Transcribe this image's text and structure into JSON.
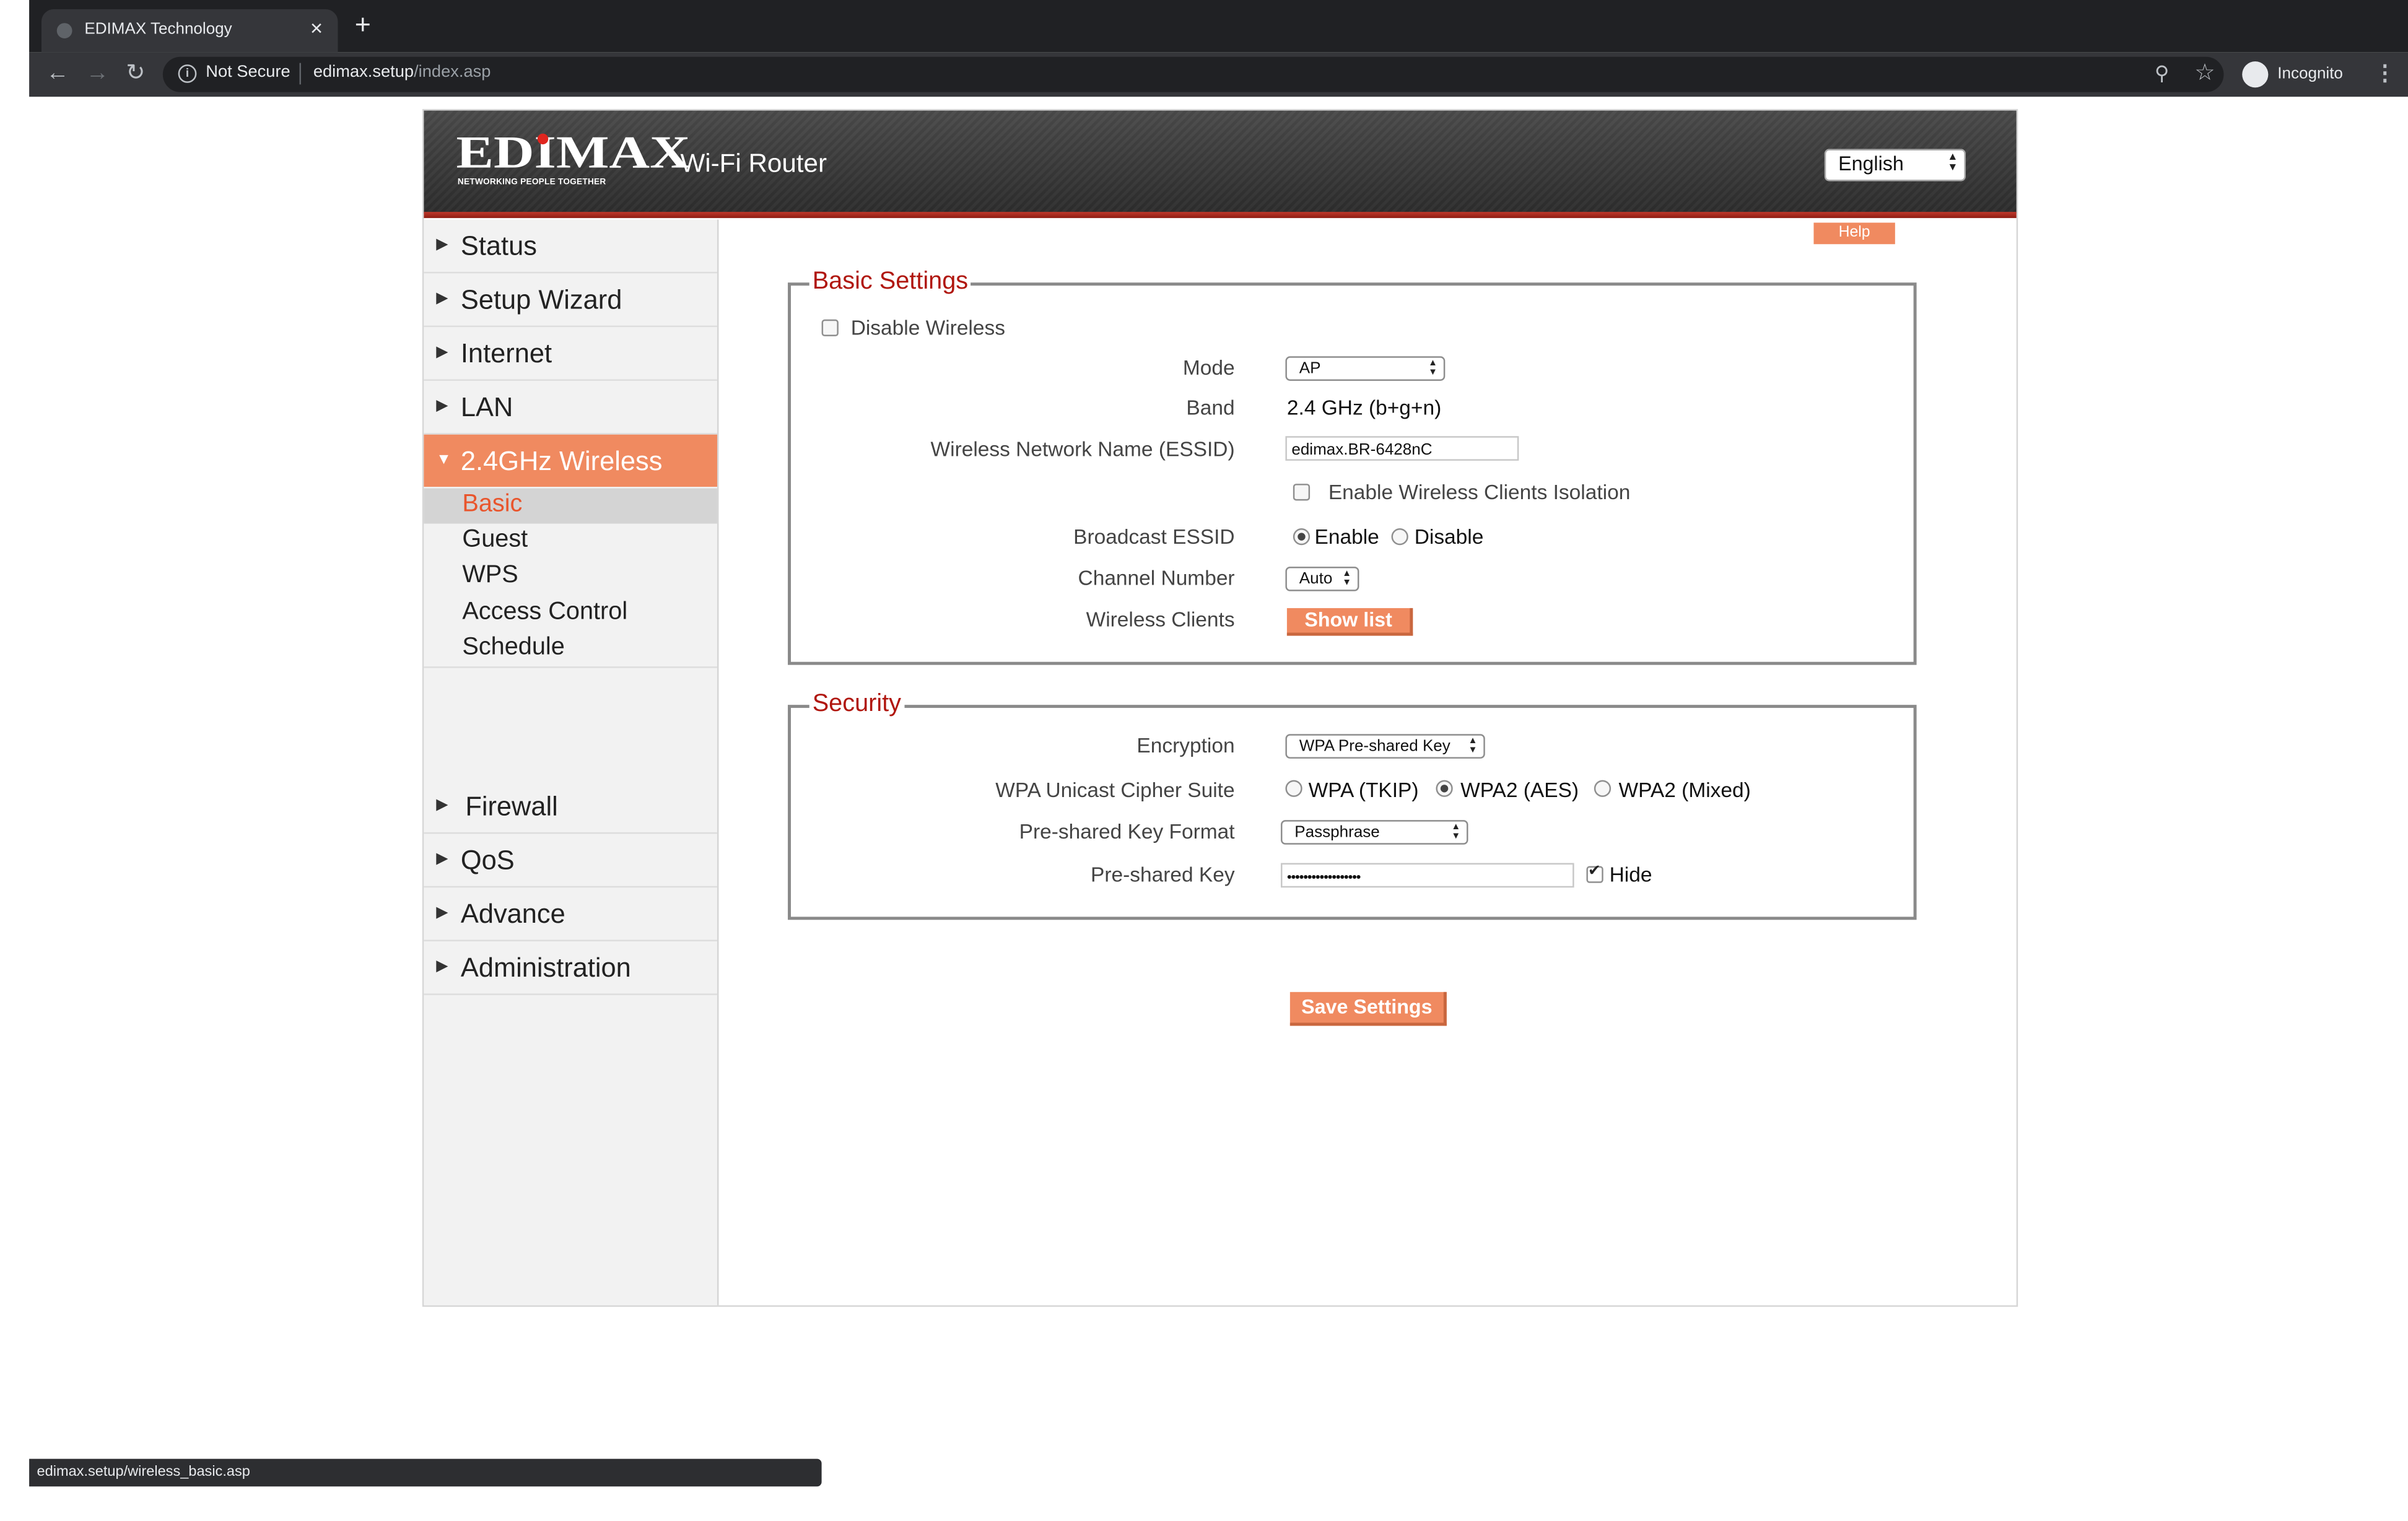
{
  "browser": {
    "tab_title": "EDIMAX Technology",
    "tab_close": "×",
    "new_tab": "+",
    "security_label": "Not Secure",
    "url_host": "edimax.setup",
    "url_path": "/index.asp",
    "profile_label": "Incognito",
    "status_url": "edimax.setup/wireless_basic.asp"
  },
  "header": {
    "logo_text": "EDIMAX",
    "logo_tagline": "NETWORKING PEOPLE TOGETHER",
    "product_name": "Wi-Fi Router",
    "language": "English"
  },
  "sidebar": {
    "items": [
      {
        "label": "Status"
      },
      {
        "label": "Setup Wizard"
      },
      {
        "label": "Internet"
      },
      {
        "label": "LAN"
      },
      {
        "label": "2.4GHz Wireless"
      },
      {
        "label": "Firewall"
      },
      {
        "label": "QoS"
      },
      {
        "label": "Advance"
      },
      {
        "label": "Administration"
      }
    ],
    "wireless_sub": [
      {
        "label": "Basic"
      },
      {
        "label": "Guest"
      },
      {
        "label": "WPS"
      },
      {
        "label": "Access Control"
      },
      {
        "label": "Schedule"
      }
    ]
  },
  "help_label": "Help",
  "basic": {
    "title": "Basic Settings",
    "disable_wireless_label": "Disable  Wireless",
    "disable_wireless_checked": false,
    "mode_label": "Mode",
    "mode_value": "AP",
    "band_label": "Band",
    "band_value": "2.4 GHz (b+g+n)",
    "essid_label": "Wireless Network Name  (ESSID)",
    "essid_value": "edimax.BR-6428nC",
    "isolation_label": "Enable Wireless Clients Isolation",
    "isolation_checked": false,
    "broadcast_label": "Broadcast ESSID",
    "broadcast_enable": "Enable",
    "broadcast_disable": "Disable",
    "broadcast_selected": "Enable",
    "channel_label": "Channel Number",
    "channel_value": "Auto",
    "clients_label": "Wireless Clients",
    "show_list": "Show list"
  },
  "security": {
    "title": "Security",
    "encryption_label": "Encryption",
    "encryption_value": "WPA Pre-shared Key",
    "cipher_label": "WPA Unicast Cipher Suite",
    "cipher_tkip": "WPA (TKIP)",
    "cipher_aes": "WPA2 (AES)",
    "cipher_mixed": "WPA2 (Mixed)",
    "cipher_selected": "WPA2 (AES)",
    "key_format_label": "Pre-shared Key Format",
    "key_format_value": "Passphrase",
    "key_label": "Pre-shared Key",
    "key_value": "••••••••••••••••••",
    "hide_label": "Hide",
    "hide_checked": true
  },
  "save_label": "Save Settings",
  "colors": {
    "accent": "#f08a60",
    "title_red": "#b0160e",
    "selected_sub": "#e9552c"
  }
}
